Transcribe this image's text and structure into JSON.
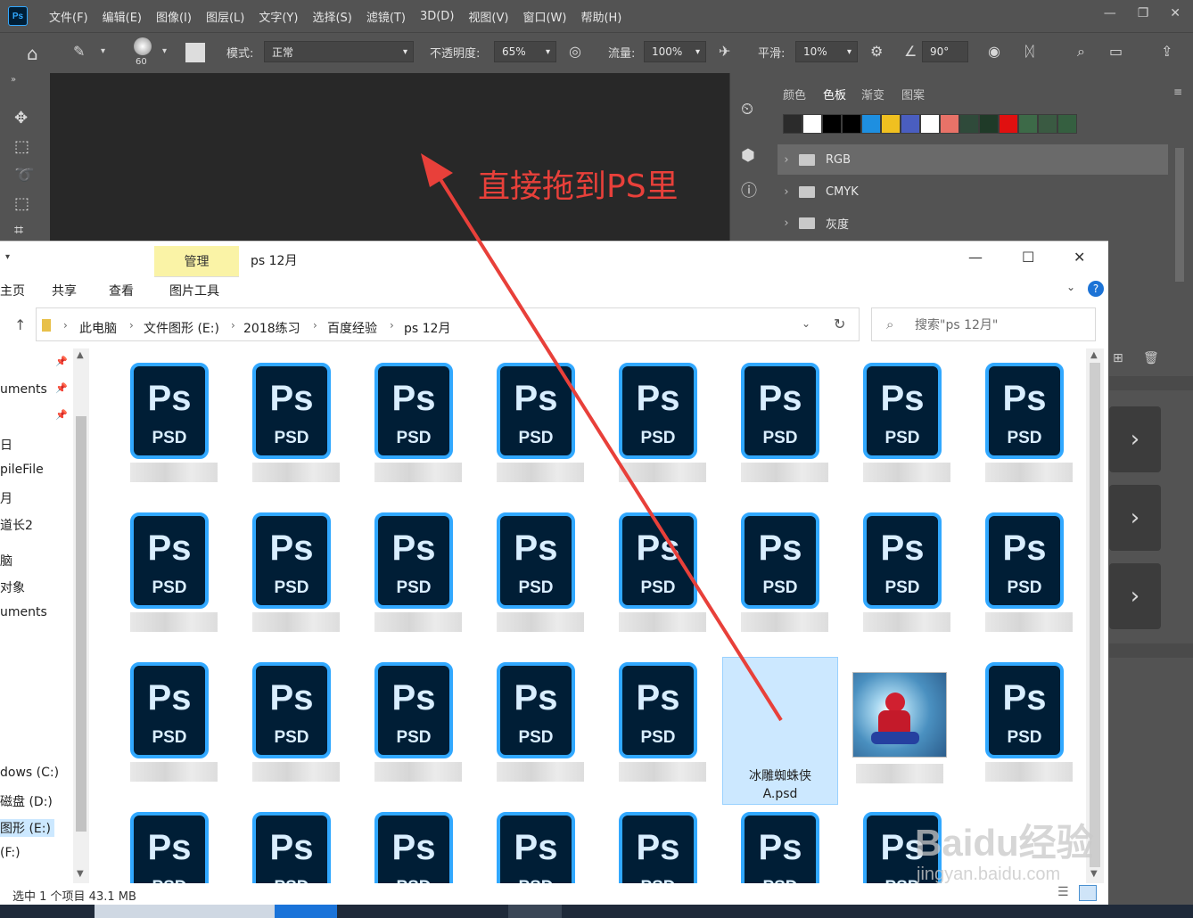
{
  "photoshop": {
    "logo_text": "Ps",
    "menu": [
      "文件(F)",
      "编辑(E)",
      "图像(I)",
      "图层(L)",
      "文字(Y)",
      "选择(S)",
      "滤镜(T)",
      "3D(D)",
      "视图(V)",
      "窗口(W)",
      "帮助(H)"
    ],
    "options": {
      "brush_size": "60",
      "mode_label": "模式:",
      "mode_value": "正常",
      "opacity_label": "不透明度:",
      "opacity_value": "65%",
      "flow_label": "流量:",
      "flow_value": "100%",
      "smooth_label": "平滑:",
      "smooth_value": "10%",
      "angle_value": "90°"
    },
    "annotation": "直接拖到PS里",
    "panel": {
      "tabs": [
        "颜色",
        "色板",
        "渐变",
        "图案"
      ],
      "active_tab": "色板",
      "swatches": [
        "#2b2b2b",
        "#ffffff",
        "#000000",
        "#000000",
        "#1e8fe0",
        "#f0c020",
        "#4a5ec0",
        "#ffffff",
        "#e87268",
        "#2f4a3a",
        "#1f3a28",
        "#e01010",
        "#3d6a48",
        "#3a5a42",
        "#355f40"
      ],
      "groups": [
        "RGB",
        "CMYK",
        "灰度"
      ]
    }
  },
  "explorer": {
    "title": "ps 12月",
    "manage_tab": "管理",
    "ribbon_tabs": [
      "主页",
      "共享",
      "查看",
      "图片工具"
    ],
    "breadcrumb": [
      "此电脑",
      "文件图形 (E:)",
      "2018练习",
      "百度经验",
      "ps 12月"
    ],
    "search_placeholder": "搜索\"ps 12月\"",
    "nav_items": [
      "uments",
      "日",
      "pileFile",
      "月",
      "道长2",
      "脑",
      "对象",
      "uments",
      "dows (C:)",
      "磁盘 (D:)",
      "图形 (E:)",
      "(F:)"
    ],
    "file_icon": {
      "ps": "Ps",
      "psd": "PSD"
    },
    "selected_file": {
      "line1": "冰雕蜘蛛侠",
      "line2": "A.psd"
    },
    "status": "选中 1 个项目  43.1 MB"
  },
  "watermark": {
    "brand": "Baidu经验",
    "url": "jingyan.baidu.com"
  }
}
